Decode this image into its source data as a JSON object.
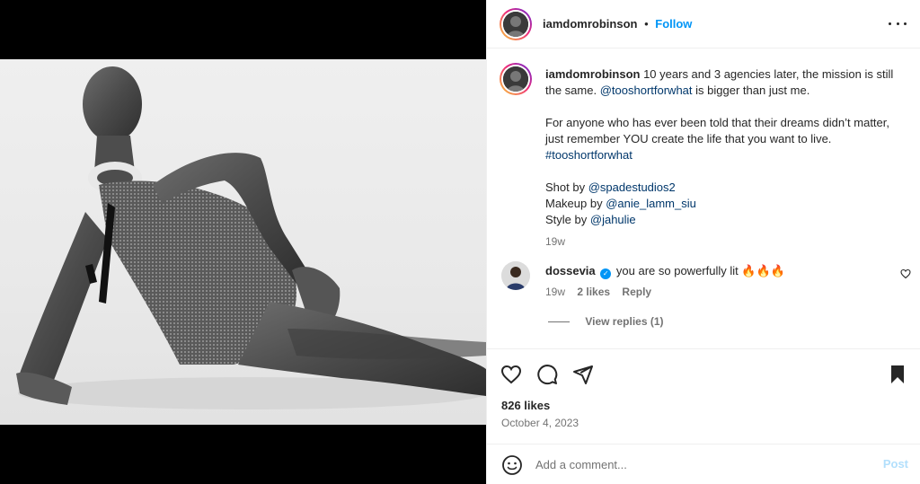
{
  "post": {
    "username": "iamdomrobinson",
    "separator": "•",
    "follow_label": "Follow",
    "more_icon": "more-horizontal-icon"
  },
  "caption": {
    "username": "iamdomrobinson",
    "line1": "10 years and 3 agencies later, the mission is still the same.",
    "mention1": "@tooshortforwhat",
    "line1_end": "is bigger than just me.",
    "paragraph2": "For anyone who has ever been told that their dreams didn’t matter, just remember YOU create the life that you want to live.",
    "hashtag": "#tooshortforwhat",
    "credit1_label": "Shot by",
    "credit1_handle": "@spadestudios2",
    "credit2_label": "Makeup by",
    "credit2_handle": "@anie_lamm_siu",
    "credit3_label": "Style by",
    "credit3_handle": "@jahulie",
    "time": "19w"
  },
  "comment": {
    "username": "dossevia",
    "text": "you are so powerfully lit 🔥🔥🔥",
    "time": "19w",
    "likes": "2 likes",
    "reply_label": "Reply",
    "view_replies": "View replies (1)"
  },
  "actions": {
    "likes": "826 likes",
    "date": "October 4, 2023"
  },
  "add_comment": {
    "placeholder": "Add a comment...",
    "post_label": "Post"
  },
  "colors": {
    "accent": "#0095f6",
    "post_disabled": "#b2dffc",
    "link": "#00376b",
    "muted": "#737373"
  }
}
